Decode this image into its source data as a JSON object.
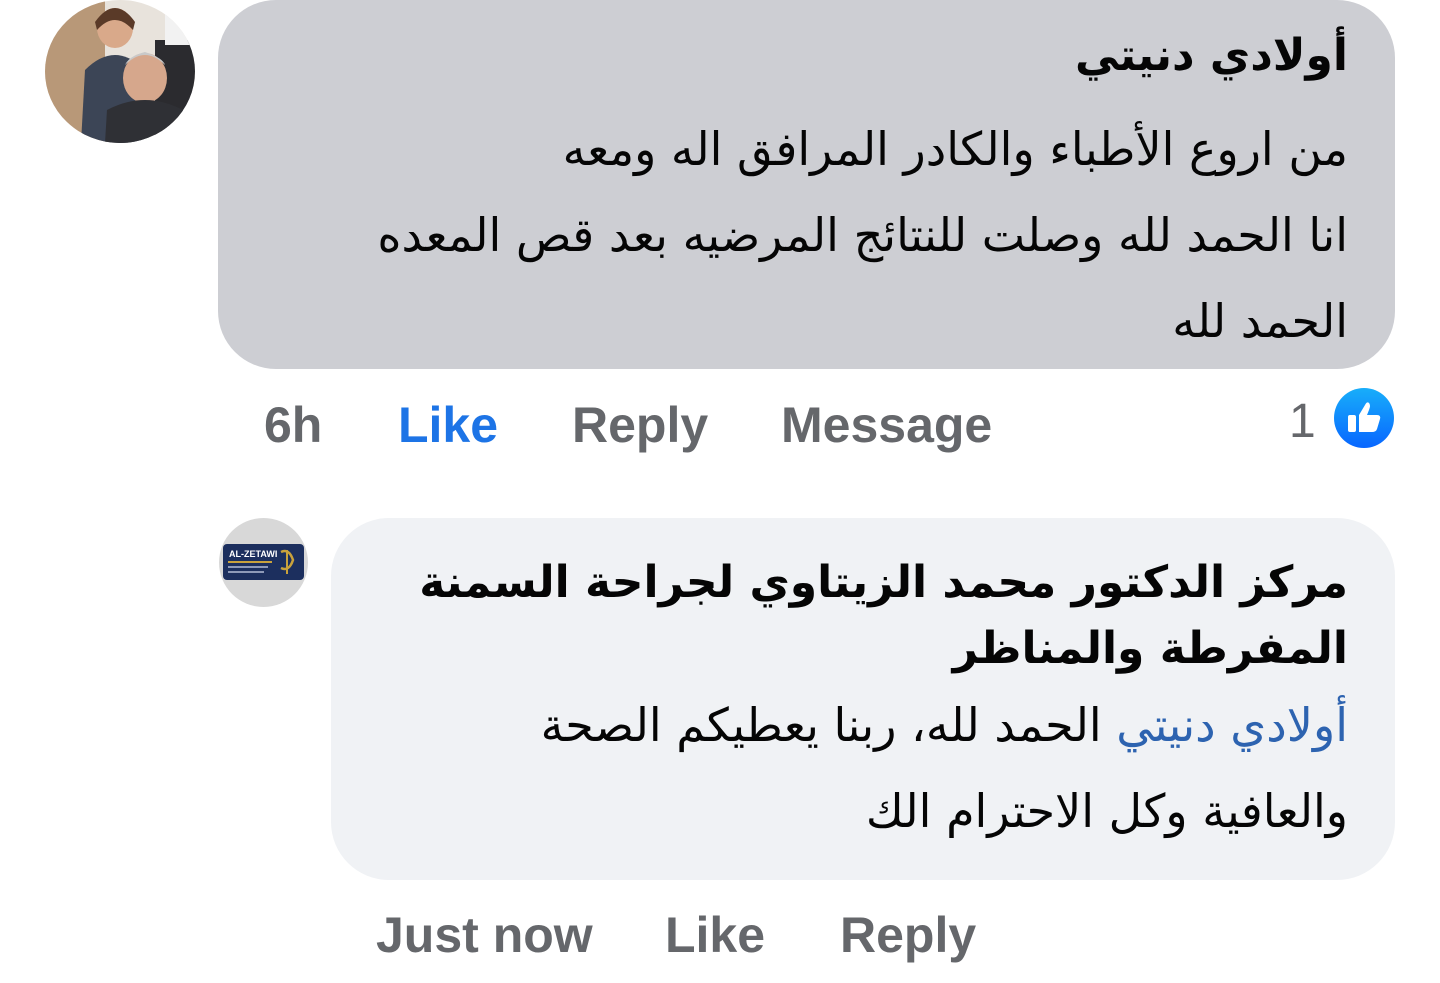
{
  "comment_1": {
    "author": "أولادي دنيتي",
    "lines": [
      "من اروع الأطباء والكادر المرافق اله ومعه",
      "انا الحمد لله وصلت للنتائج المرضيه بعد قص المعده",
      "الحمد لله"
    ],
    "time": "6h",
    "like_label": "Like",
    "reply_label": "Reply",
    "message_label": "Message",
    "reaction_count": "1",
    "reaction_icon": "thumbs-up-icon",
    "like_color": "#1d74e6"
  },
  "reply_1": {
    "author_line_1": "مركز الدكتور محمد الزيتاوي لجراحة السمنة",
    "author_line_2": "المفرطة والمناظر",
    "mention": "أولادي دنيتي",
    "text_line_1": "الحمد لله، ربنا يعطيكم الصحة",
    "text_line_2": "والعافية وكل الاحترام الك",
    "avatar_logo_text": "AL-ZETAWI",
    "time": "Just now",
    "like_label": "Like",
    "reply_label": "Reply",
    "mention_color": "#2d63b0"
  },
  "colors": {
    "bubble_1_bg": "#cdced3",
    "bubble_2_bg": "#f0f2f5",
    "action_gray": "#65676b"
  }
}
